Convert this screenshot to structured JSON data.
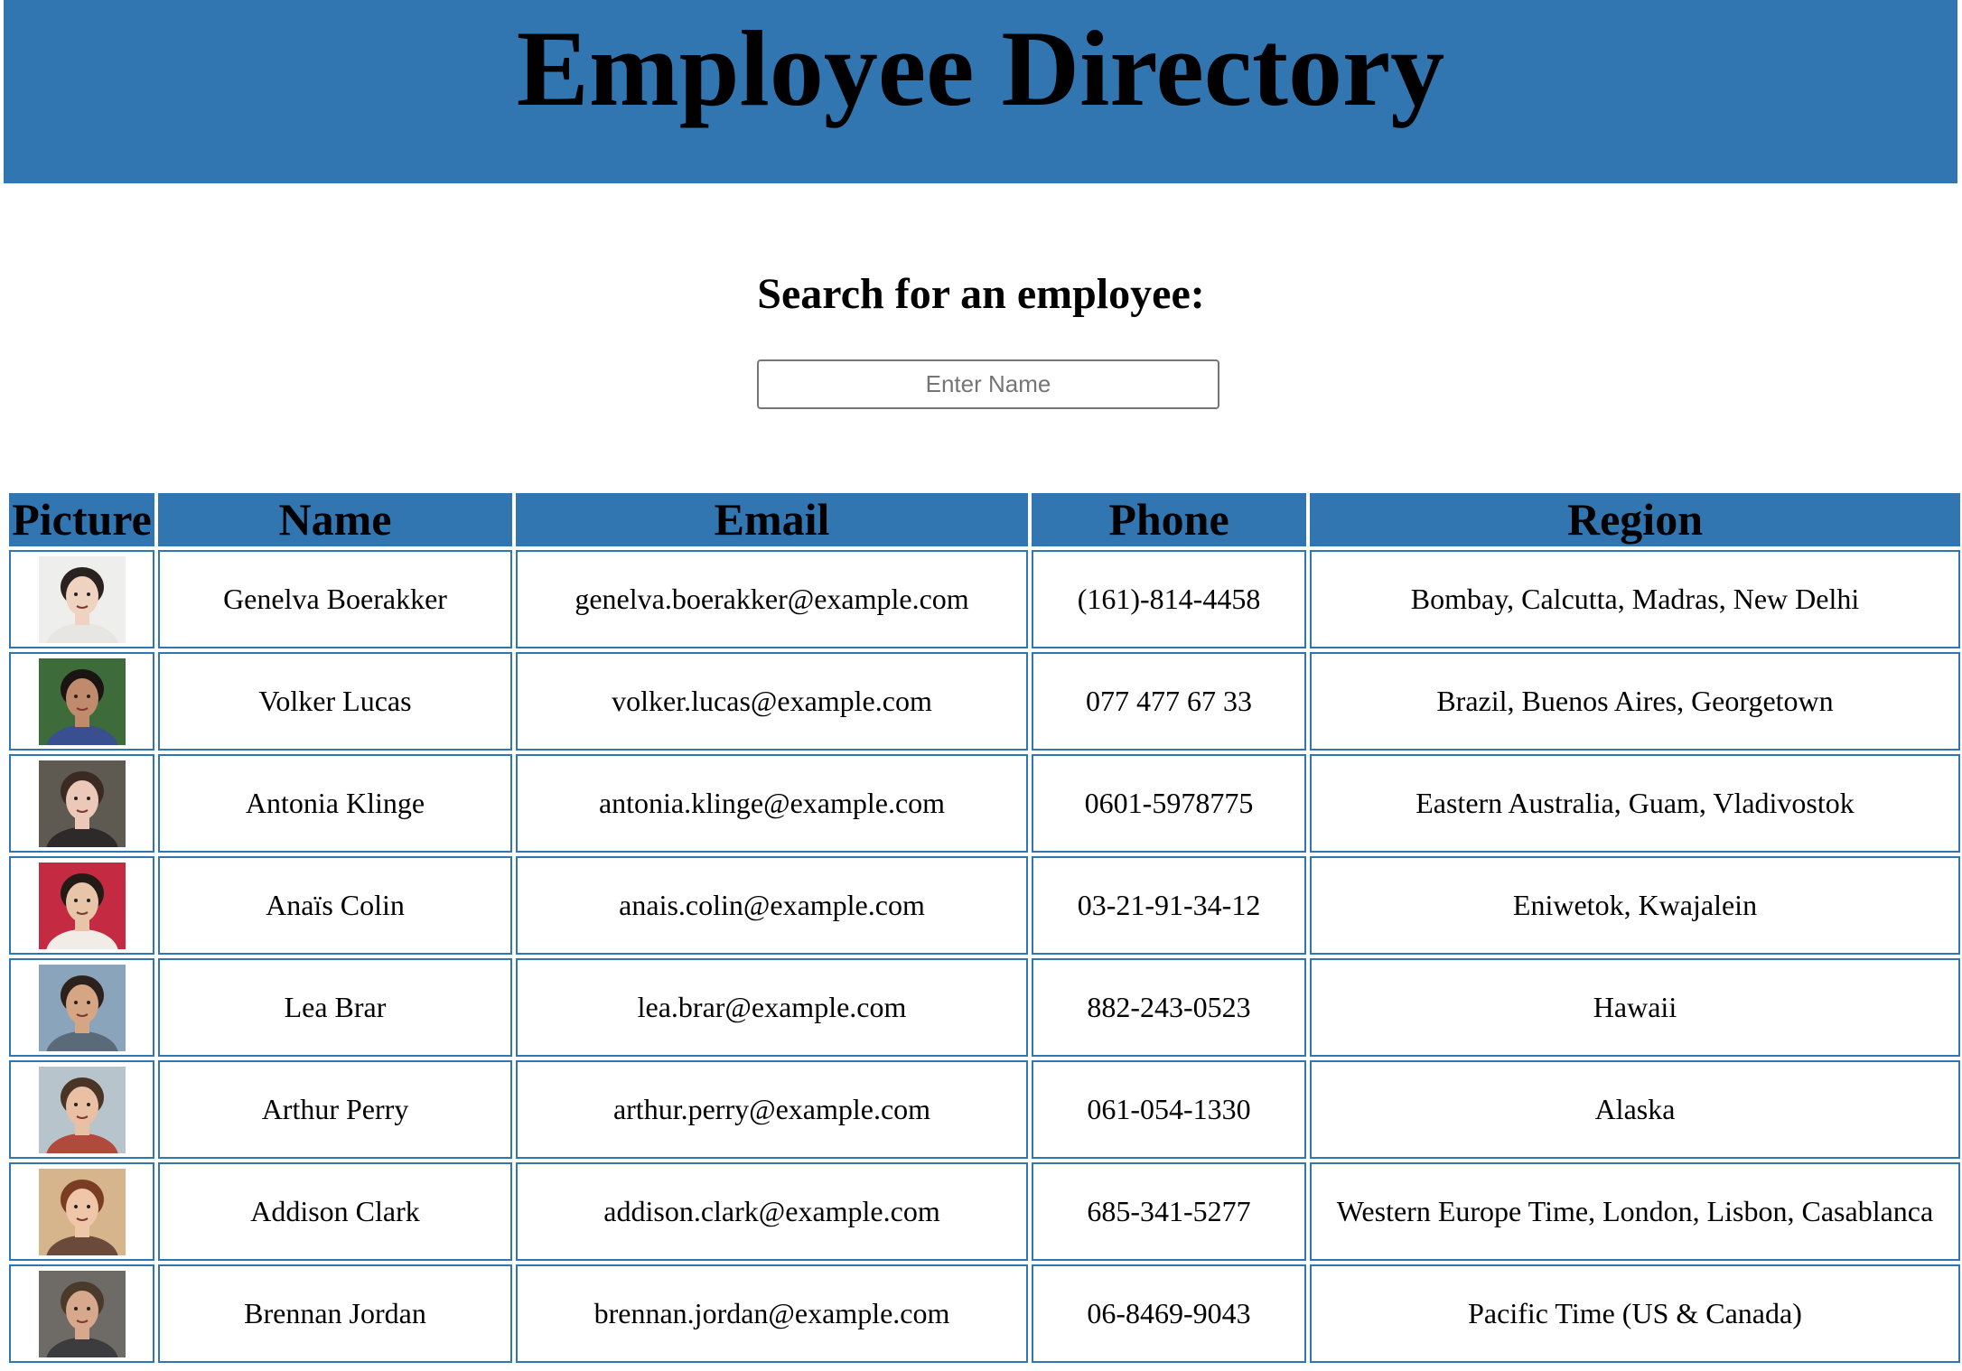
{
  "header": {
    "title": "Employee Directory",
    "background_color": "#3175b1"
  },
  "search": {
    "heading": "Search for an employee:",
    "placeholder": "Enter Name",
    "value": ""
  },
  "table": {
    "columns": [
      "Picture",
      "Name",
      "Email",
      "Phone",
      "Region"
    ],
    "rows": [
      {
        "name": "Genelva Boerakker",
        "email": "genelva.boerakker@example.com",
        "phone": "(161)-814-4458",
        "region": "Bombay, Calcutta, Madras, New Delhi",
        "avatar": {
          "bg": "#eeeeec",
          "skin": "#f0d2c0",
          "hair": "#2a2220",
          "shirt": "#e8e6e2"
        }
      },
      {
        "name": "Volker Lucas",
        "email": "volker.lucas@example.com",
        "phone": "077 477 67 33",
        "region": "Brazil, Buenos Aires, Georgetown",
        "avatar": {
          "bg": "#3e6b3a",
          "skin": "#c08a6c",
          "hair": "#1a1412",
          "shirt": "#3a4f8f"
        }
      },
      {
        "name": "Antonia Klinge",
        "email": "antonia.klinge@example.com",
        "phone": "0601-5978775",
        "region": "Eastern Australia, Guam, Vladivostok",
        "avatar": {
          "bg": "#5e5a52",
          "skin": "#ecc8b8",
          "hair": "#3a2a22",
          "shirt": "#2e2a2a"
        }
      },
      {
        "name": "Anaïs Colin",
        "email": "anais.colin@example.com",
        "phone": "03-21-91-34-12",
        "region": "Eniwetok, Kwajalein",
        "avatar": {
          "bg": "#c42a42",
          "skin": "#e8c4a8",
          "hair": "#241a16",
          "shirt": "#f2ece6"
        }
      },
      {
        "name": "Lea Brar",
        "email": "lea.brar@example.com",
        "phone": "882-243-0523",
        "region": "Hawaii",
        "avatar": {
          "bg": "#8aa4bc",
          "skin": "#d6a684",
          "hair": "#2c211c",
          "shirt": "#5a6a78"
        }
      },
      {
        "name": "Arthur Perry",
        "email": "arthur.perry@example.com",
        "phone": "061-054-1330",
        "region": "Alaska",
        "avatar": {
          "bg": "#b8c4cc",
          "skin": "#eac0a4",
          "hair": "#4a3426",
          "shirt": "#b04a3c"
        }
      },
      {
        "name": "Addison Clark",
        "email": "addison.clark@example.com",
        "phone": "685-341-5277",
        "region": "Western Europe Time, London, Lisbon, Casablanca",
        "avatar": {
          "bg": "#d6b48c",
          "skin": "#f0c6a8",
          "hair": "#7a3c22",
          "shirt": "#6a4a3a"
        }
      },
      {
        "name": "Brennan Jordan",
        "email": "brennan.jordan@example.com",
        "phone": "06-8469-9043",
        "region": "Pacific Time (US & Canada)",
        "avatar": {
          "bg": "#6e6a66",
          "skin": "#d8a88c",
          "hair": "#4a3a2c",
          "shirt": "#3c3c3e"
        }
      }
    ]
  }
}
